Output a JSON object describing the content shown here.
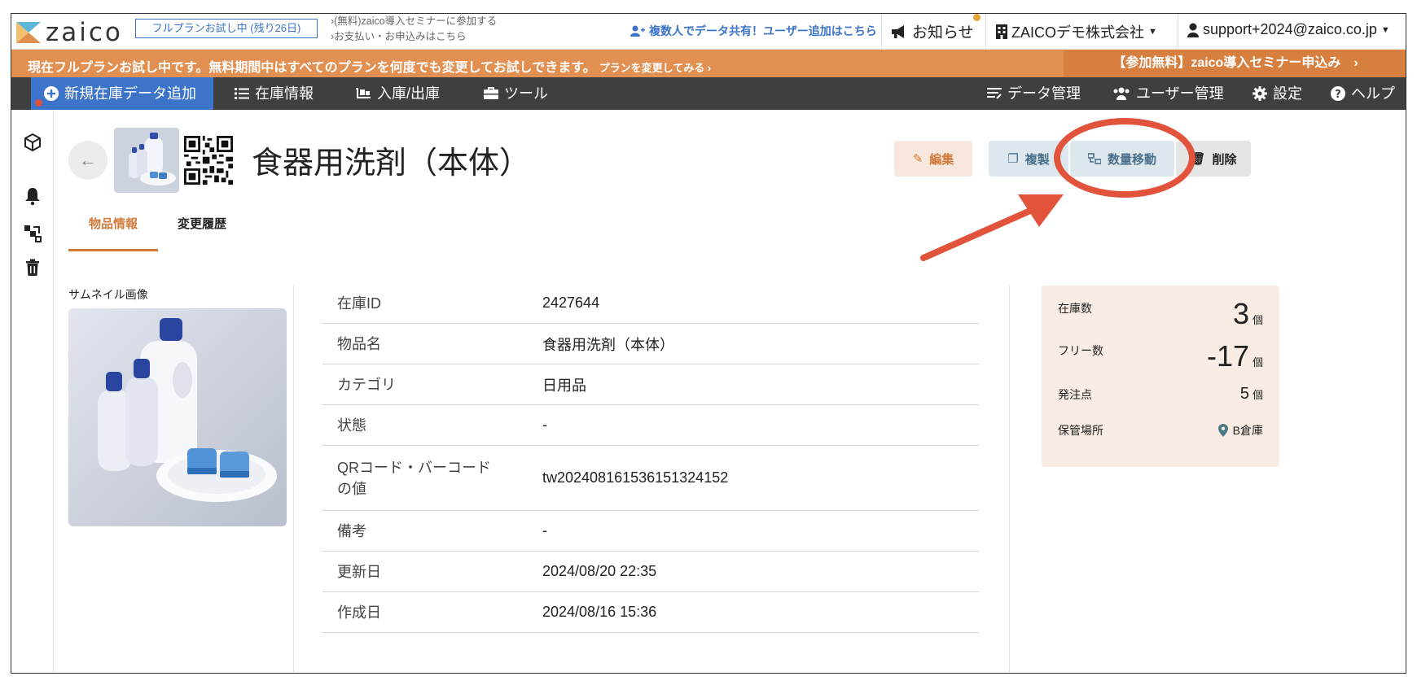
{
  "brand": {
    "logo_text": "zaico"
  },
  "topbar": {
    "trial_badge": "フルプランお試し中 (残り26日)",
    "seminar_link": "›(無料)zaico導入セミナーに参加する",
    "payment_link": "›お支払い・お申込みはこちら",
    "share_link": "複数人でデータ共有！ユーザー追加はこちら",
    "notice": "お知らせ",
    "company": "ZAICOデモ株式会社",
    "user": "support+2024@zaico.co.jp"
  },
  "banner": {
    "text": "現在フルプランお試し中です。無料期間中はすべてのプランを何度でも変更してお試しできます。",
    "change_plan": "プランを変更してみる ›",
    "seminar_cta": "【参加無料】zaico導入セミナー申込み　›"
  },
  "nav": {
    "add_item": "新規在庫データ追加",
    "inventory": "在庫情報",
    "in_out": "入庫/出庫",
    "tools": "ツール",
    "data_mgmt": "データ管理",
    "user_mgmt": "ユーザー管理",
    "settings": "設定",
    "help": "ヘルプ"
  },
  "item": {
    "title": "食器用洗剤（本体）",
    "actions": {
      "edit": "編集",
      "copy": "複製",
      "move_qty": "数量移動",
      "delete": "削除"
    },
    "tabs": {
      "info": "物品情報",
      "history": "変更履歴"
    },
    "thumbnail_label": "サムネイル画像",
    "details": [
      {
        "label": "在庫ID",
        "value": "2427644"
      },
      {
        "label": "物品名",
        "value": "食器用洗剤（本体）"
      },
      {
        "label": "カテゴリ",
        "value": "日用品"
      },
      {
        "label": "状態",
        "value": "-"
      },
      {
        "label": "QRコード・バーコードの値",
        "value": "tw202408161536151324152"
      },
      {
        "label": "備考",
        "value": "-"
      },
      {
        "label": "更新日",
        "value": "2024/08/20 22:35"
      },
      {
        "label": "作成日",
        "value": "2024/08/16 15:36"
      }
    ],
    "stock": {
      "quantity_label": "在庫数",
      "quantity": "3",
      "quantity_unit": "個",
      "free_label": "フリー数",
      "free": "-17",
      "free_unit": "個",
      "reorder_label": "発注点",
      "reorder": "5",
      "reorder_unit": "個",
      "location_label": "保管場所",
      "location": "B倉庫"
    }
  },
  "colors": {
    "accent_blue": "#3b74c8",
    "banner_orange": "#e29052",
    "nav_dark": "#3f3f3f",
    "edit_orange": "#d27a3a",
    "annotation_red": "#e1533b"
  }
}
